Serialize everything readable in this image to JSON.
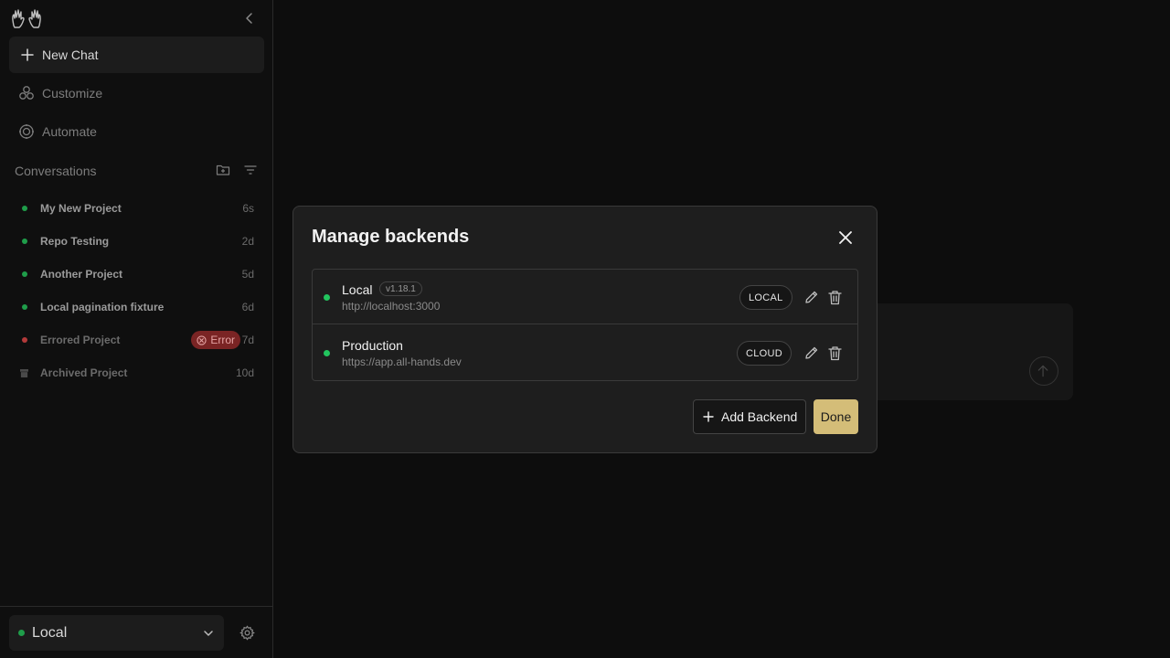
{
  "sidebar": {
    "new_chat": "New Chat",
    "customize": "Customize",
    "automate": "Automate",
    "conversations_label": "Conversations",
    "conversations": [
      {
        "name": "My New Project",
        "time": "6s",
        "status": "green"
      },
      {
        "name": "Repo Testing",
        "time": "2d",
        "status": "green"
      },
      {
        "name": "Another Project",
        "time": "5d",
        "status": "green"
      },
      {
        "name": "Local pagination fixture",
        "time": "6d",
        "status": "green"
      },
      {
        "name": "Errored Project",
        "time": "7d",
        "status": "red",
        "badge": "Error"
      },
      {
        "name": "Archived Project",
        "time": "10d",
        "status": "archived"
      }
    ],
    "backend_selected": "Local"
  },
  "modal": {
    "title": "Manage backends",
    "backends": [
      {
        "name": "Local",
        "version": "v1.18.1",
        "url": "http://localhost:3000",
        "type": "LOCAL"
      },
      {
        "name": "Production",
        "version": "",
        "url": "https://app.all-hands.dev",
        "type": "CLOUD"
      }
    ],
    "add_label": "Add Backend",
    "done_label": "Done"
  },
  "colors": {
    "status_green": "#22c55e",
    "accent": "#d4bd78",
    "error_red": "#7a2424"
  }
}
